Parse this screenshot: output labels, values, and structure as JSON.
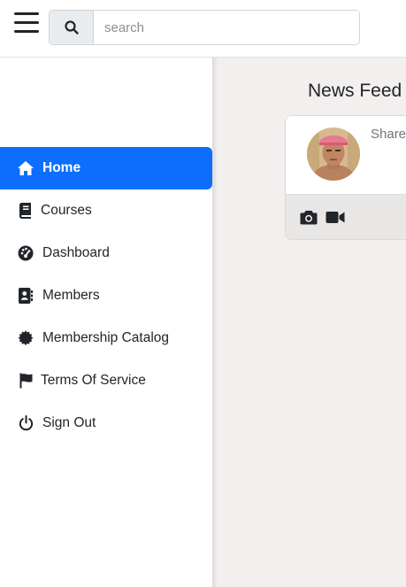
{
  "header": {
    "search": {
      "placeholder": "search",
      "value": ""
    }
  },
  "sidebar": {
    "items": [
      {
        "label": "Home",
        "icon": "home-icon",
        "active": true
      },
      {
        "label": "Courses",
        "icon": "book-icon",
        "active": false
      },
      {
        "label": "Dashboard",
        "icon": "gauge-icon",
        "active": false
      },
      {
        "label": "Members",
        "icon": "address-book-icon",
        "active": false
      },
      {
        "label": "Membership Catalog",
        "icon": "certificate-icon",
        "active": false
      },
      {
        "label": "Terms Of Service",
        "icon": "flag-icon",
        "active": false
      },
      {
        "label": "Sign Out",
        "icon": "power-icon",
        "active": false
      }
    ]
  },
  "feed": {
    "title": "News Feed",
    "share_prompt": "Share"
  },
  "colors": {
    "accent": "#0d6efd",
    "main_bg": "#f2efee"
  }
}
